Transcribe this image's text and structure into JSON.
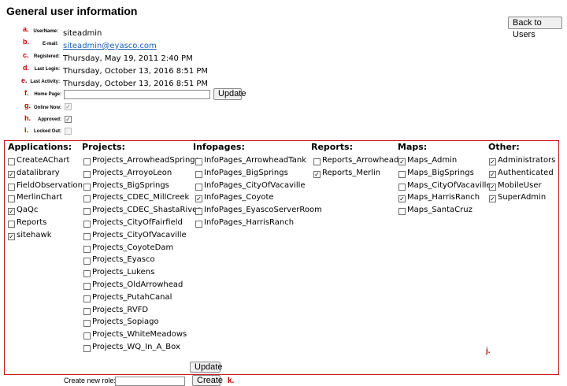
{
  "page_title": "General user information",
  "back_button": "Back to Users",
  "fields": [
    {
      "marker": "a.",
      "label": "UserName:",
      "value": "siteadmin"
    },
    {
      "marker": "b.",
      "label": "E-mail:",
      "value": "siteadmin@eyasco.com"
    },
    {
      "marker": "c.",
      "label": "Registered:",
      "value": "Thursday, May 19, 2011 2:40 PM"
    },
    {
      "marker": "d.",
      "label": "Last Login:",
      "value": "Thursday, October 13, 2016 8:51 PM"
    },
    {
      "marker": "e.",
      "label": "Last Activity:",
      "value": "Thursday, October 13, 2016 8:51 PM"
    },
    {
      "marker": "f.",
      "label": "Home Page:",
      "value": ""
    },
    {
      "marker": "g.",
      "label": "Online Now:",
      "value": "checked-disabled"
    },
    {
      "marker": "h.",
      "label": "Approved:",
      "value": "checked"
    },
    {
      "marker": "i.",
      "label": "Locked Out:",
      "value": "unchecked-disabled"
    }
  ],
  "update_label": "Update",
  "roles": {
    "applications": {
      "title": "Applications:",
      "items": [
        {
          "label": "CreateAChart",
          "checked": false
        },
        {
          "label": "datalibrary",
          "checked": true
        },
        {
          "label": "FieldObservation",
          "checked": false
        },
        {
          "label": "MerlinChart",
          "checked": false
        },
        {
          "label": "QaQc",
          "checked": true
        },
        {
          "label": "Reports",
          "checked": false
        },
        {
          "label": "sitehawk",
          "checked": true
        }
      ]
    },
    "projects": {
      "title": "Projects:",
      "items": [
        {
          "label": "Projects_ArrowheadSprings",
          "checked": false
        },
        {
          "label": "Projects_ArroyoLeon",
          "checked": false
        },
        {
          "label": "Projects_BigSprings",
          "checked": false
        },
        {
          "label": "Projects_CDEC_MillCreek",
          "checked": false
        },
        {
          "label": "Projects_CDEC_ShastaRiver",
          "checked": false
        },
        {
          "label": "Projects_CityOfFairfield",
          "checked": false
        },
        {
          "label": "Projects_CityOfVacaville",
          "checked": false
        },
        {
          "label": "Projects_CoyoteDam",
          "checked": false
        },
        {
          "label": "Projects_Eyasco",
          "checked": false
        },
        {
          "label": "Projects_Lukens",
          "checked": false
        },
        {
          "label": "Projects_OldArrowhead",
          "checked": false
        },
        {
          "label": "Projects_PutahCanal",
          "checked": false
        },
        {
          "label": "Projects_RVFD",
          "checked": false
        },
        {
          "label": "Projects_Sopiago",
          "checked": false
        },
        {
          "label": "Projects_WhiteMeadows",
          "checked": false
        },
        {
          "label": "Projects_WQ_In_A_Box",
          "checked": false
        }
      ]
    },
    "infopages": {
      "title": "Infopages:",
      "items": [
        {
          "label": "InfoPages_ArrowheadTank",
          "checked": false
        },
        {
          "label": "InfoPages_BigSprings",
          "checked": false
        },
        {
          "label": "InfoPages_CityOfVacaville",
          "checked": false
        },
        {
          "label": "InfoPages_Coyote",
          "checked": true
        },
        {
          "label": "InfoPages_EyascoServerRoom",
          "checked": false
        },
        {
          "label": "InfoPages_HarrisRanch",
          "checked": false
        }
      ]
    },
    "reports": {
      "title": "Reports:",
      "items": [
        {
          "label": "Reports_Arrowhead",
          "checked": false
        },
        {
          "label": "Reports_Merlin",
          "checked": true
        }
      ]
    },
    "maps": {
      "title": "Maps:",
      "items": [
        {
          "label": "Maps_Admin",
          "checked": true
        },
        {
          "label": "Maps_BigSprings",
          "checked": false
        },
        {
          "label": "Maps_CityOfVacaville",
          "checked": false
        },
        {
          "label": "Maps_HarrisRanch",
          "checked": true
        },
        {
          "label": "Maps_SantaCruz",
          "checked": false
        }
      ]
    },
    "other": {
      "title": "Other:",
      "items": [
        {
          "label": "Administrators",
          "checked": true
        },
        {
          "label": "Authenticated",
          "checked": true
        },
        {
          "label": "MobileUser",
          "checked": true
        },
        {
          "label": "SuperAdmin",
          "checked": true
        }
      ]
    }
  },
  "panel_marker": "j.",
  "create_role_label": "Create new role:",
  "create_role_value": "",
  "create_button": "Create",
  "create_marker": "k."
}
